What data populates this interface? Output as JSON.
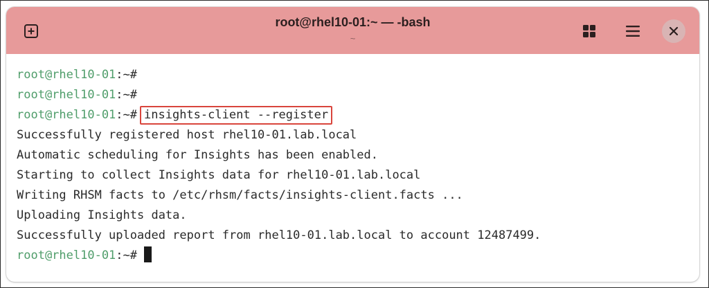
{
  "window": {
    "title": "root@rhel10-01:~ — -bash",
    "subtitle": "~"
  },
  "toolbar": {
    "new_tab_icon": "plus-square-icon",
    "grid_icon": "grid-icon",
    "menu_icon": "hamburger-menu-icon",
    "close_icon": "close-icon"
  },
  "colors": {
    "titlebar": "#e79a9a",
    "prompt": "#4f9d6a",
    "highlight_box": "#d9453c"
  },
  "terminal": {
    "prompt_user": "root@rhel10-01",
    "prompt_path": ":~#",
    "command": "insights-client --register",
    "output": [
      "Successfully registered host rhel10-01.lab.local",
      "Automatic scheduling for Insights has been enabled.",
      "Starting to collect Insights data for rhel10-01.lab.local",
      "Writing RHSM facts to /etc/rhsm/facts/insights-client.facts ...",
      "Uploading Insights data.",
      "Successfully uploaded report from rhel10-01.lab.local to account 12487499."
    ]
  }
}
